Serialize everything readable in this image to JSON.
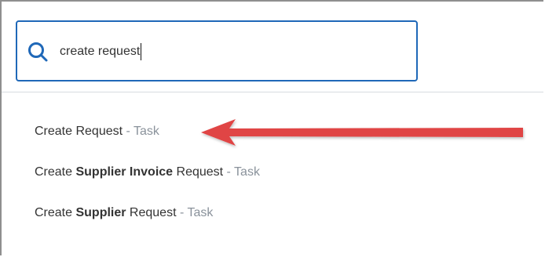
{
  "search": {
    "value": "create request"
  },
  "results": [
    {
      "prefix": "Create ",
      "bold": "",
      "suffix": "Request",
      "separator": " - ",
      "type": "Task"
    },
    {
      "prefix": "Create ",
      "bold": "Supplier Invoice",
      "suffix": " Request",
      "separator": " - ",
      "type": "Task"
    },
    {
      "prefix": "Create ",
      "bold": "Supplier",
      "suffix": " Request",
      "separator": " - ",
      "type": "Task"
    }
  ],
  "colors": {
    "search_border": "#1f68b8",
    "arrow": "#e04545",
    "task_tag": "#8a929b"
  },
  "icons": {
    "search": "search-icon",
    "annotation_arrow": "arrow-left-icon"
  }
}
